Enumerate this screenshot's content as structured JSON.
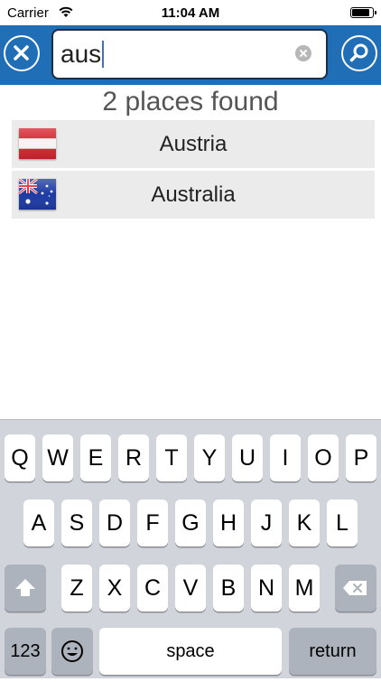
{
  "status_bar": {
    "carrier": "Carrier",
    "time": "11:04 AM"
  },
  "search": {
    "query": "aus",
    "cancel_icon": "close-circle-icon",
    "search_icon": "magnifier-icon",
    "clear_icon": "clear-text-icon"
  },
  "results": {
    "count_text": "2 places found",
    "items": [
      {
        "name": "Austria",
        "flag": "austria-flag"
      },
      {
        "name": "Australia",
        "flag": "australia-flag"
      }
    ]
  },
  "keyboard": {
    "row1": [
      "Q",
      "W",
      "E",
      "R",
      "T",
      "Y",
      "U",
      "I",
      "O",
      "P"
    ],
    "row2": [
      "A",
      "S",
      "D",
      "F",
      "G",
      "H",
      "J",
      "K",
      "L"
    ],
    "row3": [
      "Z",
      "X",
      "C",
      "V",
      "B",
      "N",
      "M"
    ],
    "numbers_label": "123",
    "space_label": "space",
    "return_label": "return"
  },
  "colors": {
    "accent": "#1f6eb6",
    "row_bg": "#ebebeb",
    "keyboard_bg": "#d1d5db"
  }
}
